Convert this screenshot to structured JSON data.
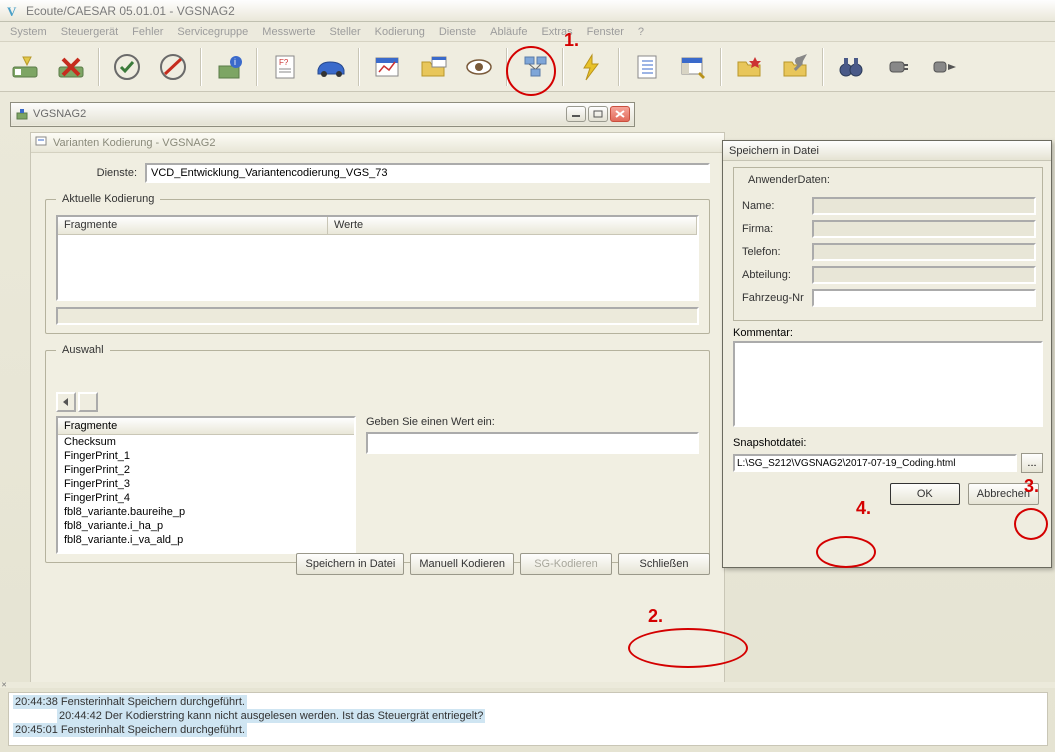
{
  "app": {
    "title": "Ecoute/CAESAR 05.01.01 - VGSNAG2",
    "icon_letter": "V"
  },
  "menu": [
    "System",
    "Steuergerät",
    "Fehler",
    "Servicegruppe",
    "Messwerte",
    "Steller",
    "Kodierung",
    "Dienste",
    "Abläufe",
    "Extras",
    "Fenster",
    "?"
  ],
  "toolbar_icons": [
    "connect",
    "disconnect",
    "|",
    "check-circle",
    "cancel-circle",
    "|",
    "ecu-info",
    "|",
    "script",
    "car",
    "|",
    "gauge",
    "folder-open",
    "eye",
    "|",
    "tree",
    "|",
    "flash",
    "|",
    "doc-list",
    "table-edit",
    "|",
    "folder-star",
    "tools",
    "|",
    "binoculars",
    "plug",
    "plug-arrow"
  ],
  "child_window": {
    "title": "VGSNAG2",
    "inner_title": "Varianten Kodierung - VGSNAG2",
    "dienste_label": "Dienste:",
    "dienste_value": "VCD_Entwicklung_Variantencodierung_VGS_73",
    "group_aktuelle": "Aktuelle Kodierung",
    "col_fragmente": "Fragmente",
    "col_werte": "Werte",
    "group_auswahl": "Auswahl",
    "listbox_header": "Fragmente",
    "fragments": [
      "Checksum",
      "FingerPrint_1",
      "FingerPrint_2",
      "FingerPrint_3",
      "FingerPrint_4",
      "fbl8_variante.baureihe_p",
      "fbl8_variante.i_ha_p",
      "fbl8_variante.i_va_ald_p"
    ],
    "wert_label": "Geben Sie einen Wert ein:",
    "buttons": {
      "save": "Speichern in Datei",
      "manual": "Manuell Kodieren",
      "sg": "SG-Kodieren",
      "close": "Schließen"
    }
  },
  "dialog": {
    "title": "Speichern in Datei",
    "group_title": "AnwenderDaten:",
    "fields": {
      "name": "Name:",
      "firma": "Firma:",
      "telefon": "Telefon:",
      "abteilung": "Abteilung:",
      "fahrzeug": "Fahrzeug-Nr"
    },
    "kommentar_label": "Kommentar:",
    "snapshot_label": "Snapshotdatei:",
    "snapshot_value": "L:\\SG_S212\\VGSNAG2\\2017-07-19_Coding.html",
    "browse": "...",
    "ok": "OK",
    "cancel": "Abbrechen"
  },
  "log": [
    "20:44:38 Fensterinhalt Speichern durchgeführt.",
    "20:44:42 Der Kodierstring kann nicht ausgelesen werden. Ist das Steuergrät entriegelt?",
    "20:45:01 Fensterinhalt Speichern durchgeführt."
  ],
  "annotations": {
    "n1": "1.",
    "n2": "2.",
    "n3": "3.",
    "n4": "4."
  },
  "colors": {
    "accent": "#d40000"
  }
}
